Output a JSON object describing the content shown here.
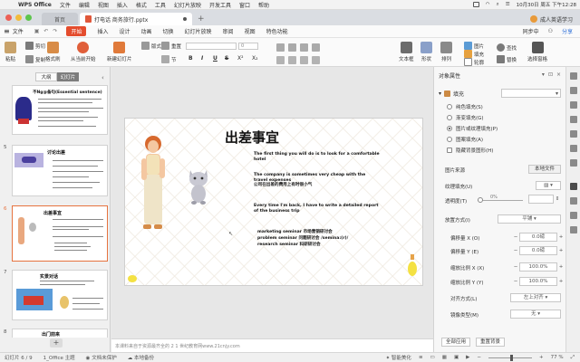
{
  "menubar": {
    "app": "WPS Office",
    "items": [
      "文件",
      "编辑",
      "视图",
      "插入",
      "格式",
      "工具",
      "幻灯片放映",
      "开发工具",
      "窗口",
      "帮助"
    ],
    "datetime": "10月30日 周五 下午12:28"
  },
  "tabs": {
    "home": "首页",
    "doc": "打电话 商务旅行.pptx",
    "user": "成人英语学习"
  },
  "ribbon_tabs": {
    "file": "文件",
    "items": [
      "开始",
      "插入",
      "设计",
      "动画",
      "切换",
      "幻灯片放映",
      "审阅",
      "视图",
      "特色功能"
    ],
    "active": "开始",
    "sync": "同步中",
    "share": "分享"
  },
  "ribbon": {
    "paste": "粘贴",
    "cut": "剪切",
    "copy": "复制",
    "format_painter": "格式刷",
    "play_from_current": "从当前开始",
    "new_slide": "新建幻灯片",
    "layout": "版式",
    "reset": "重置",
    "section": "节",
    "textbox": "文本框",
    "shape": "形状",
    "arrange": "排列",
    "picture": "图片",
    "fill": "填充",
    "outline": "轮廓",
    "find": "查找",
    "replace": "替换",
    "select_pane": "选择窗格",
    "font_name": "",
    "font_size": "0",
    "bold": "B",
    "italic": "I",
    "underline": "U",
    "strike": "S",
    "sup": "X²",
    "sub": "X₂"
  },
  "left_panel": {
    "tab_outline": "大纲",
    "tab_slides": "幻灯片",
    "thumbs": [
      {
        "num": "",
        "title": "不Ng@备句(Essential sentence)"
      },
      {
        "num": "5",
        "title": "讨论出差"
      },
      {
        "num": "6",
        "title": "出差事宜"
      },
      {
        "num": "7",
        "title": "实景对话"
      },
      {
        "num": "8",
        "title": "出门前来"
      }
    ]
  },
  "slide": {
    "title": "出差事宜",
    "p1": "The first thing you will do is to look for a comfortable hotel",
    "p2a": "The company is sometimes very cheap with the travel expenses",
    "p2b": "公司在出差的费用上有时很小气",
    "p3": "Every time I'm back, I have to write a detailed report of the business trip",
    "bullets": [
      "marketing seminar 市场营销研讨会",
      "problem seminar 问题研讨会 /semina:(r)/",
      "research seminar 科研研讨会"
    ]
  },
  "notes": "本课料来自于资源最齐全的 2 1 世纪教育网www.21cnjy.com",
  "props": {
    "header": "对象属性",
    "fill_section": "填充",
    "fill_options": [
      "纯色填充(S)",
      "渐变填充(G)",
      "图片或纹理填充(P)",
      "图案填充(A)",
      "隐藏背景图形(H)"
    ],
    "fill_selected": 2,
    "picture_source": "图片来源",
    "local_file": "本地文件",
    "texture_fill": "纹理填充(U)",
    "transparency": "透明度(T)",
    "transparency_value": "0%",
    "placement": "放置方式(I)",
    "placement_value": "平铺",
    "offset_x": "偏移量 X (O)",
    "offset_x_value": "0.0磅",
    "offset_y": "偏移量 Y (E)",
    "offset_y_value": "0.0磅",
    "scale_x": "缩放比例 X (X)",
    "scale_x_value": "100.0%",
    "scale_y": "缩放比例 Y (Y)",
    "scale_y_value": "100.0%",
    "align": "对齐方式(L)",
    "align_value": "左上对齐",
    "mirror": "镜像类型(M)",
    "mirror_value": "无",
    "apply_all": "全部应用",
    "reset_bg": "重置背景"
  },
  "status": {
    "slide": "幻灯片 6 / 9",
    "theme": "1_Office 主题",
    "protect": "文档未保护",
    "backup": "本地备份",
    "beautify": "智能美化",
    "zoom": "77 %"
  },
  "colors": {
    "accent": "#e44c2d",
    "selected_thumb": "#e6733f",
    "share": "#2d6fd8"
  }
}
